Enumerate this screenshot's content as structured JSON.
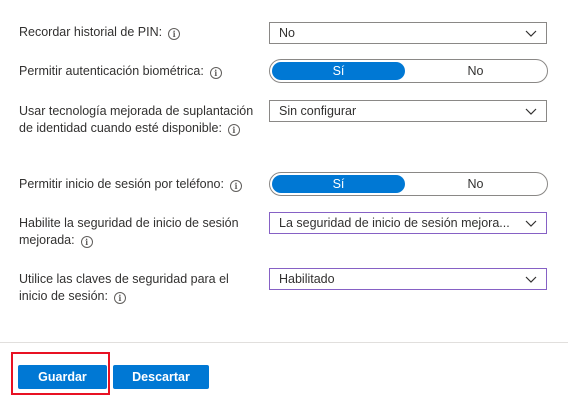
{
  "settings": [
    {
      "label": "Recordar historial de PIN:",
      "control": "dropdown",
      "value": "No"
    },
    {
      "label": "Permitir autenticación biométrica:",
      "control": "toggle",
      "on_label": "Sí",
      "off_label": "No",
      "selected": "Sí"
    },
    {
      "label": "Usar tecnología mejorada de suplantación de identidad cuando esté disponible:",
      "control": "dropdown",
      "value": "Sin configurar"
    },
    {
      "label": "Permitir inicio de sesión por teléfono:",
      "control": "toggle",
      "on_label": "Sí",
      "off_label": "No",
      "selected": "Sí"
    },
    {
      "label": "Habilite la seguridad de inicio de sesión mejorada:",
      "control": "dropdown",
      "value": "La seguridad de inicio de sesión mejora..."
    },
    {
      "label": "Utilice las claves de seguridad para el inicio de sesión:",
      "control": "dropdown",
      "value": "Habilitado"
    }
  ],
  "footer": {
    "save_label": "Guardar",
    "discard_label": "Descartar"
  },
  "colors": {
    "accent": "#0078d4",
    "highlight": "#e81123",
    "focus_border": "#8661c5"
  },
  "icons": {
    "info": "info-icon",
    "dropdown": "chevron-down-icon"
  }
}
